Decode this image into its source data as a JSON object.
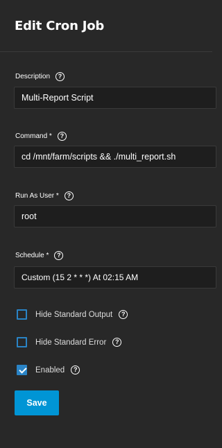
{
  "header": {
    "title": "Edit Cron Job"
  },
  "form": {
    "description": {
      "label": "Description",
      "value": "Multi-Report Script"
    },
    "command": {
      "label": "Command *",
      "value": "cd /mnt/farm/scripts && ./multi_report.sh"
    },
    "run_as_user": {
      "label": "Run As User *",
      "value": "root"
    },
    "schedule": {
      "label": "Schedule *",
      "value": "Custom (15 2 * * *) At 02:15 AM"
    },
    "hide_stdout": {
      "label": "Hide Standard Output",
      "checked": false
    },
    "hide_stderr": {
      "label": "Hide Standard Error",
      "checked": false
    },
    "enabled": {
      "label": "Enabled",
      "checked": true
    },
    "help_glyph": "?"
  },
  "actions": {
    "save_label": "Save"
  },
  "colors": {
    "background": "#282828",
    "accent": "#0095d5",
    "checkbox": "#2a84c6"
  }
}
